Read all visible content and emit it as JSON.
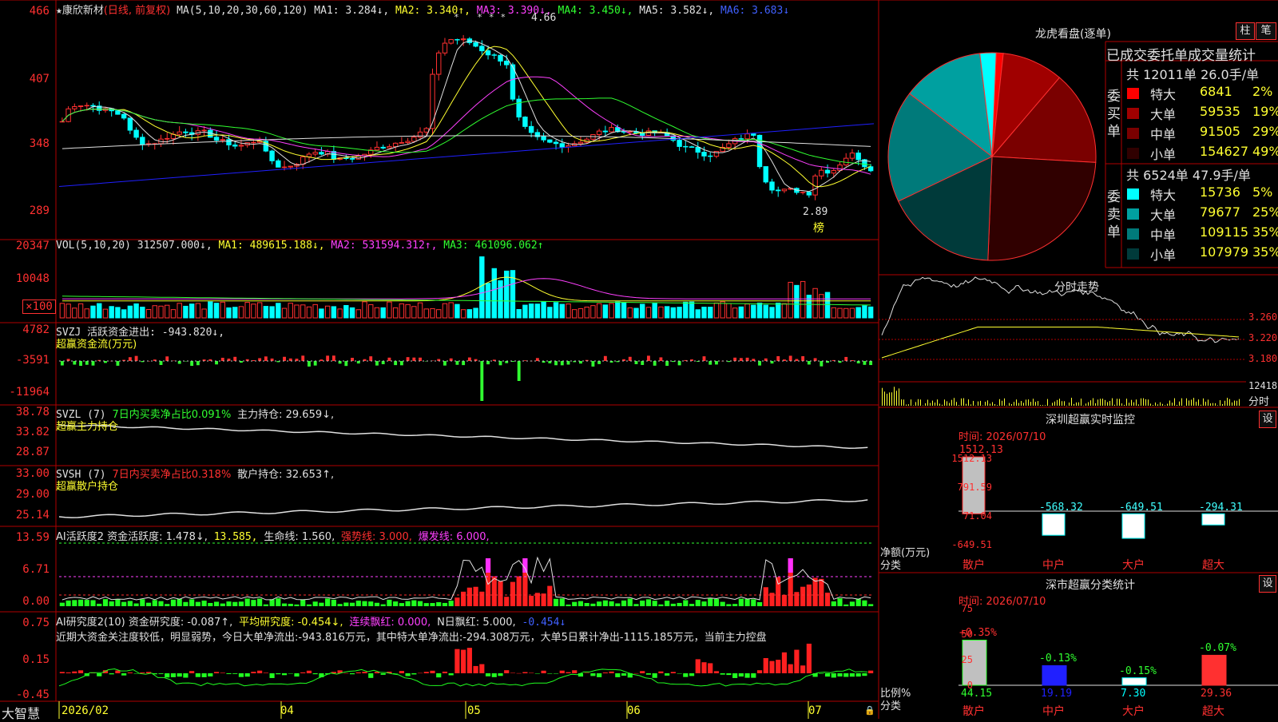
{
  "kline": {
    "star": "★",
    "stock_name": "康欣新材",
    "period": "(日线, 前复权)",
    "ma_label": "MA(5,10,20,30,60,120)",
    "ma1": "MA1: 3.284↓,",
    "ma2": "MA2: 3.340↑,",
    "ma3": "MA3: 3.390↓,",
    "ma4": "MA4: 3.450↓,",
    "ma5": "MA5: 3.582↓,",
    "ma6": "MA6: 3.683↓",
    "y_labels": [
      "466",
      "407",
      "348",
      "289"
    ],
    "high_mark": "4.66",
    "low_mark": "2.89",
    "bang": "榜",
    "stars": "* ***"
  },
  "vol": {
    "label": "VOL(5,10,20) 312507.000↓,",
    "ma1": "MA1: 489615.188↓,",
    "ma2": "MA2: 531594.312↑,",
    "ma3": "MA3: 461096.062↑",
    "y_labels": [
      "20347",
      "10048"
    ],
    "unit": "×100"
  },
  "svzj": {
    "label": "SVZJ  活跃资金进出: -943.820↓,",
    "subtitle": "超赢资金流(万元)",
    "y_labels": [
      "4782",
      "-3591",
      "-11964"
    ]
  },
  "svzl": {
    "label": "SVZL (7)",
    "label2": "7日内买卖净占比0.091%",
    "label3": "主力持仓: 29.659↓,",
    "subtitle": "超赢主力持仓",
    "y_labels": [
      "38.78",
      "33.82",
      "28.87"
    ]
  },
  "svsh": {
    "label": "SVSH (7)",
    "label2": "7日内买卖净占比0.318%",
    "label3": "散户持仓: 32.653↑,",
    "subtitle": "超赢散户持仓",
    "y_labels": [
      "33.00",
      "29.00",
      "25.14"
    ]
  },
  "ai1": {
    "label": "AI活跃度2 资金活跃度: 1.478↓,",
    "v2": "13.585,",
    "v3": "生命线: 1.560,",
    "v4": "强势线: 3.000,",
    "v5": "爆发线: 6.000,",
    "y_labels": [
      "13.59",
      "6.71",
      "0.00"
    ]
  },
  "ai2": {
    "label": "AI研究度2(10) 资金研究度: -0.087↑,",
    "v2": "平均研究度: -0.454↓,",
    "v3": "连续飘红: 0.000,",
    "v4": "N日飘红: 5.000,",
    "v5": "-0.454↓",
    "comment": "近期大资金关注度较低，明显弱势，今日大单净流出:-943.816万元，其中特大单净流出:-294.308万元，大单5日累计净出-1115.185万元，当前主力控盘",
    "y_labels": [
      "0.75",
      "0.15",
      "-0.45"
    ]
  },
  "xaxis": {
    "brand": "大智慧",
    "dates": [
      "2026/02",
      "04",
      "05",
      "06",
      "07"
    ]
  },
  "lhb": {
    "title": "龙虎看盘(逐单)",
    "btn1": "柱",
    "btn2": "笔",
    "header": "已成交委托单成交量统计",
    "buy_label": "委买单",
    "sell_label": "委卖单",
    "buy_total": "共 12011单 26.0手/单",
    "sell_total": "共 6524单 47.9手/单",
    "buy_rows": [
      {
        "name": "特大",
        "vol": "6841",
        "pct": "2%",
        "color": "#ff0000"
      },
      {
        "name": "大单",
        "vol": "59535",
        "pct": "19%",
        "color": "#a00000"
      },
      {
        "name": "中单",
        "vol": "91505",
        "pct": "29%",
        "color": "#7a0000"
      },
      {
        "name": "小单",
        "vol": "154627",
        "pct": "49%",
        "color": "#300000"
      }
    ],
    "sell_rows": [
      {
        "name": "特大",
        "vol": "15736",
        "pct": "5%",
        "color": "#00ffff"
      },
      {
        "name": "大单",
        "vol": "79677",
        "pct": "25%",
        "color": "#00a0a0"
      },
      {
        "name": "中单",
        "vol": "109115",
        "pct": "35%",
        "color": "#007a7a"
      },
      {
        "name": "小单",
        "vol": "107979",
        "pct": "35%",
        "color": "#003a3a"
      }
    ]
  },
  "fenshi": {
    "title": "分时走势",
    "prices": [
      "3.260",
      "3.220",
      "3.180"
    ],
    "vol": "12418",
    "vol_label": "分时"
  },
  "monitor": {
    "title": "深圳超赢实时监控",
    "settings": "设",
    "time": "时间: 2026/07/10",
    "y_labels": [
      "1512.13",
      "791.59",
      "71.04",
      "-649.51"
    ],
    "unit": "净额(万元)",
    "cat_label": "分类",
    "bars": [
      {
        "name": "散户",
        "value": 1512.13,
        "text": "1512.13"
      },
      {
        "name": "中户",
        "value": -568.32,
        "text": "-568.32"
      },
      {
        "name": "大户",
        "value": -649.51,
        "text": "-649.51"
      },
      {
        "name": "超大",
        "value": -294.31,
        "text": "-294.31"
      }
    ]
  },
  "classify": {
    "title": "深市超赢分类统计",
    "settings": "设",
    "time": "时间: 2026/07/10",
    "y_labels": [
      "75",
      "50",
      "25",
      "0"
    ],
    "unit": "比例%",
    "cat_label": "分类",
    "bars": [
      {
        "name": "散户",
        "value": 44.15,
        "text": "44.15",
        "delta": "+0.35%"
      },
      {
        "name": "中户",
        "value": 19.19,
        "text": "19.19",
        "delta": "-0.13%"
      },
      {
        "name": "大户",
        "value": 7.3,
        "text": "7.30",
        "delta": "-0.15%"
      },
      {
        "name": "超大",
        "value": 29.36,
        "text": "29.36",
        "delta": "-0.07%"
      }
    ]
  },
  "chart_data": [
    {
      "type": "pie",
      "title": "龙虎看盘(逐单)",
      "categories": [
        "委买特大",
        "委买大单",
        "委买中单",
        "委买小单",
        "委卖特大",
        "委卖大单",
        "委卖中单",
        "委卖小单"
      ],
      "values": [
        6841,
        59535,
        91505,
        154627,
        15736,
        79677,
        109115,
        107979
      ]
    },
    {
      "type": "bar",
      "title": "深圳超赢实时监控",
      "categories": [
        "散户",
        "中户",
        "大户",
        "超大"
      ],
      "values": [
        1512.13,
        -568.32,
        -649.51,
        -294.31
      ],
      "ylabel": "净额(万元)",
      "ylim": [
        -649.51,
        1512.13
      ]
    },
    {
      "type": "bar",
      "title": "深市超赢分类统计",
      "categories": [
        "散户",
        "中户",
        "大户",
        "超大"
      ],
      "values": [
        44.15,
        19.19,
        7.3,
        29.36
      ],
      "ylabel": "比例%",
      "ylim": [
        0,
        75
      ]
    }
  ]
}
